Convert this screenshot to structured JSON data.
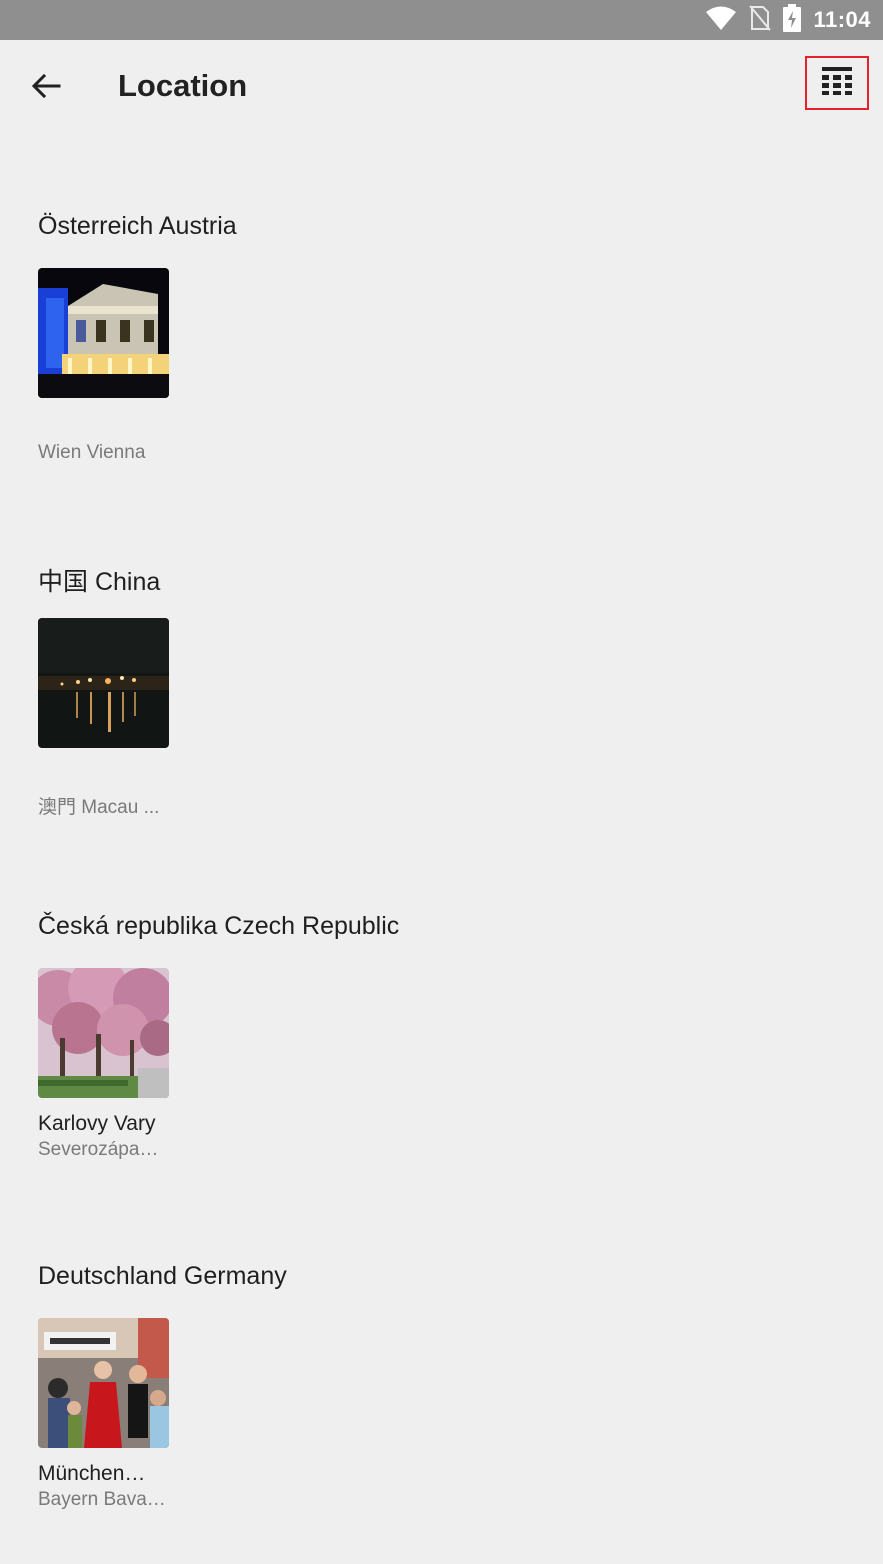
{
  "status_bar": {
    "time": "11:04",
    "icons": [
      "wifi-icon",
      "no-sim-icon",
      "battery-charging-icon"
    ]
  },
  "header": {
    "back_icon": "arrow-back-icon",
    "title": "Location",
    "view_toggle_icon": "grid-view-icon"
  },
  "sections": [
    {
      "title": "Österreich Austria",
      "places": [
        {
          "name": "",
          "subtitle": "Wien Vienna",
          "thumbnail": "night-theater-building"
        }
      ]
    },
    {
      "title": "中国 China",
      "places": [
        {
          "name": "",
          "subtitle": "澳門 Macau ...",
          "thumbnail": "night-harbor-lights"
        }
      ]
    },
    {
      "title": "Česká republika Czech Republic",
      "places": [
        {
          "name": "Karlovy Vary",
          "subtitle": "Severozápa…",
          "thumbnail": "pink-blossom-trees"
        }
      ]
    },
    {
      "title": "Deutschland Germany",
      "places": [
        {
          "name": "München…",
          "subtitle": "Bayern Bava…",
          "thumbnail": "street-crowd-bondelen"
        }
      ]
    }
  ],
  "colors": {
    "status_bar": "#8f8f8f",
    "background": "#efefef",
    "highlight_border": "#e5222b"
  }
}
